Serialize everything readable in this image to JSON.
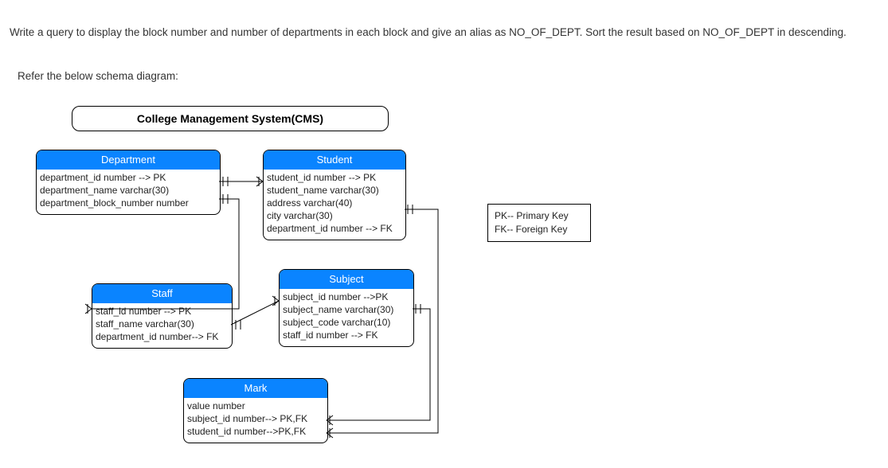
{
  "question_text": "Write a query to display the block number and number of departments in each block and give an alias as NO_OF_DEPT. Sort the result based on NO_OF_DEPT in descending.",
  "subheading": "Refer the below schema diagram:",
  "system_title": "College Management System(CMS)",
  "legend": {
    "pk": "PK-- Primary Key",
    "fk": "FK-- Foreign Key"
  },
  "entities": {
    "department": {
      "name": "Department",
      "fields": [
        "department_id number --> PK",
        "department_name varchar(30)",
        "department_block_number number"
      ]
    },
    "student": {
      "name": "Student",
      "fields": [
        "student_id number --> PK",
        "student_name varchar(30)",
        "address varchar(40)",
        "city varchar(30)",
        "department_id number --> FK"
      ]
    },
    "staff": {
      "name": "Staff",
      "fields": [
        "staff_id number --> PK",
        "staff_name varchar(30)",
        "department_id number--> FK"
      ]
    },
    "subject": {
      "name": "Subject",
      "fields": [
        "subject_id number -->PK",
        "subject_name varchar(30)",
        "subject_code varchar(10)",
        "staff_id number --> FK"
      ]
    },
    "mark": {
      "name": "Mark",
      "fields": [
        "value number",
        "subject_id number--> PK,FK",
        "student_id number-->PK,FK"
      ]
    }
  }
}
